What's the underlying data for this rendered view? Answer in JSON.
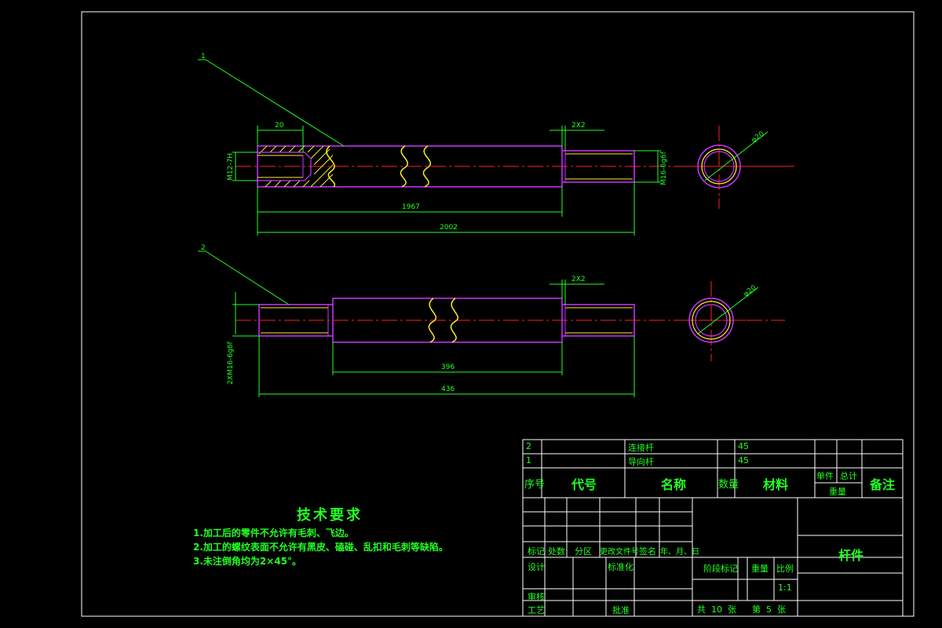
{
  "colors": {
    "background": "#000000",
    "frame": "#ffffff",
    "dimension": "#22ff22",
    "outline": "#cc33ff",
    "hatch": "#ffee22",
    "centerline": "#ff2222"
  },
  "part1": {
    "balloon": "1",
    "dim_20": "20",
    "dim_chamfer": "2X2",
    "dim_1967": "1967",
    "dim_2002": "2002",
    "thread_left": "M12-7H",
    "thread_right": "M16-6g6f",
    "dim_phi": "φ20"
  },
  "part2": {
    "balloon": "2",
    "dim_chamfer": "2X2",
    "dim_396": "396",
    "dim_436": "436",
    "thread": "2XM16-6g6f",
    "dim_phi": "φ20"
  },
  "tech_req": {
    "title": "技术要求",
    "items": [
      "1.加工后的零件不允许有毛刺、飞边。",
      "2.加工的螺纹表面不允许有黑皮、磕碰、乱扣和毛刺等缺陷。",
      "3.未注倒角均为2×45°。"
    ]
  },
  "bom": {
    "rows": [
      {
        "no": "2",
        "name": "连接杆",
        "material": "45"
      },
      {
        "no": "1",
        "name": "导向杆",
        "material": "45"
      }
    ],
    "headers": {
      "no": "序号",
      "code": "代号",
      "name": "名称",
      "qty": "数量",
      "material": "材料",
      "unit": "单件",
      "total": "总计",
      "weight": "重量",
      "remark": "备注"
    }
  },
  "title_block": {
    "labels": {
      "mark": "标记",
      "count": "处数",
      "zone": "分区",
      "change_doc": "更改文件号",
      "sign": "签名",
      "date": "年、月、日",
      "design": "设计",
      "standard": "标准化",
      "review": "审核",
      "process": "工艺",
      "approve": "批准",
      "stage": "阶段标记",
      "weight": "重量",
      "scale": "比例"
    },
    "part_name": "杆件",
    "scale_value": "1:1",
    "sheets": "共  10  张",
    "sheet_no": "第  5  张"
  }
}
